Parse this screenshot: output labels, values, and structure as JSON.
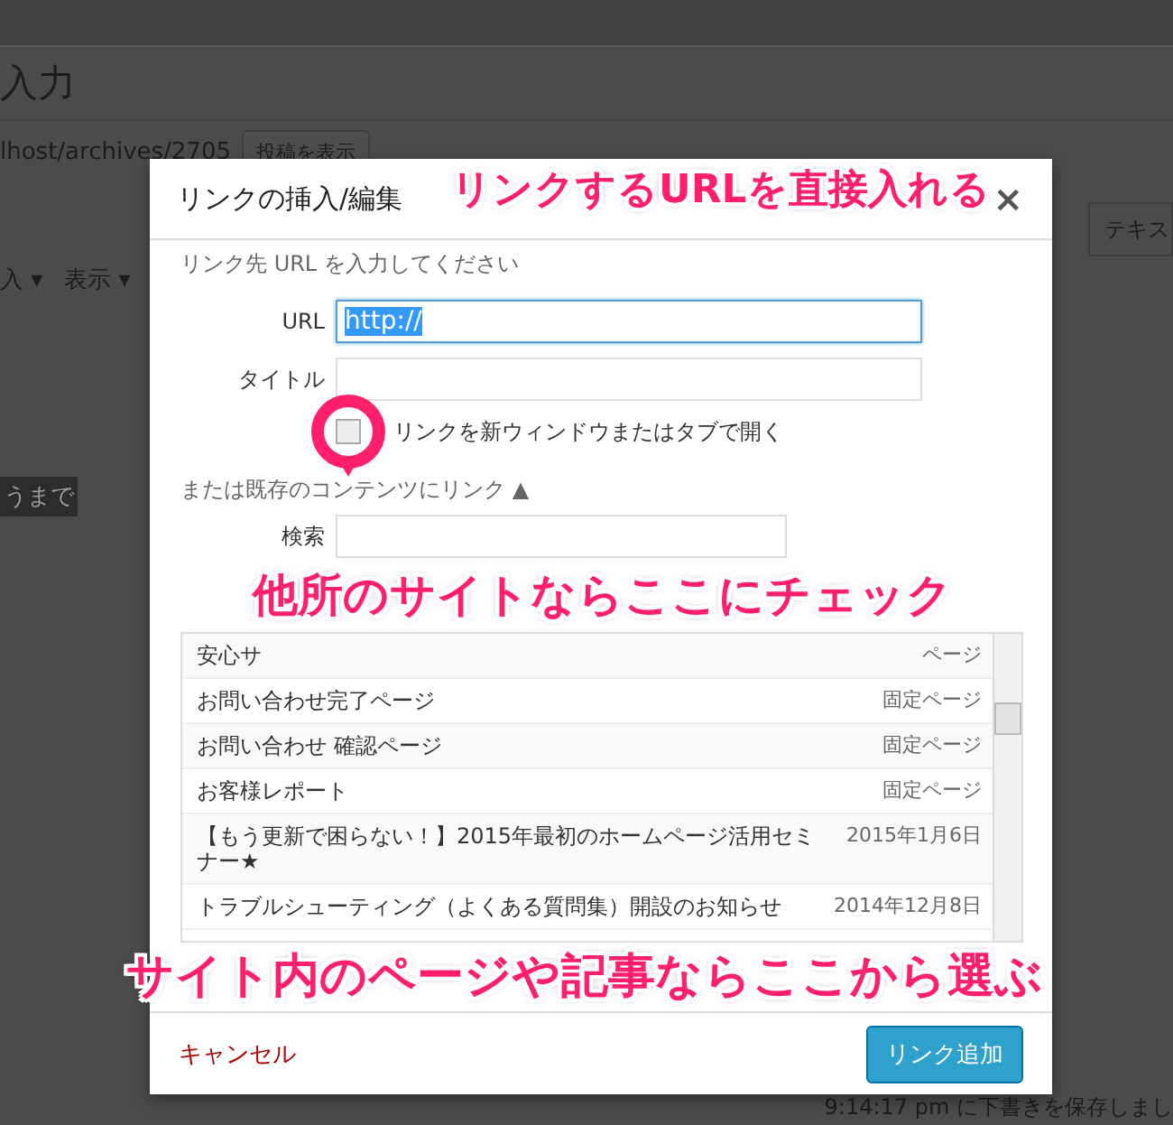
{
  "editor": {
    "title": "入力",
    "permalink": "lhost/archives/2705",
    "view_post_button": "投稿を表示",
    "tab": "テキス",
    "menus": [
      {
        "label": "入",
        "caret": "▾"
      },
      {
        "label": "表示",
        "caret": "▾"
      }
    ],
    "selected_text": "うまで",
    "autosave": "9:14:17 pm に下書きを保存しまし"
  },
  "dialog": {
    "title": "リンクの挿入/編集",
    "close": "×",
    "intro": "リンク先 URL を入力してください",
    "url_label": "URL",
    "url_value": "http://",
    "title_label": "タイトル",
    "new_tab": {
      "label": "リンクを新ウィンドウまたはタブで開く",
      "checked": false
    },
    "existing_label": "または既存のコンテンツにリンク",
    "existing_toggle": "▲",
    "search_label": "検索",
    "results": [
      {
        "title": "安心サ",
        "type": "ページ"
      },
      {
        "title": "お問い合わせ完了ページ",
        "type": "固定ページ"
      },
      {
        "title": "お問い合わせ 確認ページ",
        "type": "固定ページ"
      },
      {
        "title": "お客様レポート",
        "type": "固定ページ"
      },
      {
        "title": "【もう更新で困らない！】2015年最初のホームページ活用セミナー★",
        "type": "2015年1月6日"
      },
      {
        "title": "トラブルシューティング（よくある質問集）開設のお知らせ",
        "type": "2014年12月8日"
      }
    ],
    "cancel": "キャンセル",
    "submit": "リンク追加"
  },
  "annotations": [
    "リンクするURLを直接入れる",
    "他所のサイトならここにチェック",
    "サイト内のページや記事ならここから選ぶ"
  ]
}
